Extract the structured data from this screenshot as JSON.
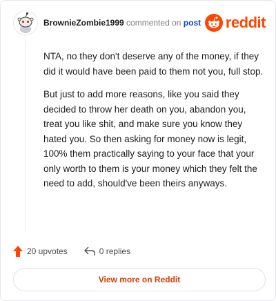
{
  "comment": {
    "author": "BrownieZombie1999",
    "action_text": "commented on",
    "post_link": "post",
    "body_paragraphs": [
      "NTA, no they don't deserve any of the money, if they did it would have been paid to them not you, full stop.",
      "But just to add more reasons, like you said they decided to throw her death on you, abandon you, treat you like shit, and make sure you know they hated you. So then asking for money now is legit, 100% them practically saying to your face that your only worth to them is your money which they felt the need to add, should've been theirs anyways."
    ]
  },
  "brand": {
    "name": "reddit",
    "color": "#ff4500",
    "icon": "reddit-alien-icon"
  },
  "actions": {
    "upvotes": "20 upvotes",
    "replies": "0 replies",
    "upvote_icon": "upvote-arrow-icon",
    "reply_icon": "reply-arrow-icon"
  },
  "footer": {
    "view_more": "View more on Reddit"
  },
  "colors": {
    "accent": "#ff4500",
    "link": "#0a4cc4",
    "button_text": "#d93a00"
  }
}
